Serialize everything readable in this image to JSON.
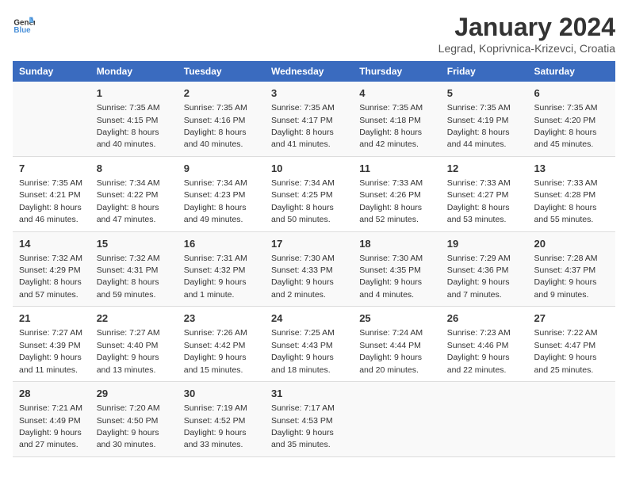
{
  "logo": {
    "line1": "General",
    "line2": "Blue"
  },
  "title": "January 2024",
  "subtitle": "Legrad, Koprivnica-Krizevci, Croatia",
  "days_header": [
    "Sunday",
    "Monday",
    "Tuesday",
    "Wednesday",
    "Thursday",
    "Friday",
    "Saturday"
  ],
  "weeks": [
    [
      {
        "day": "",
        "sunrise": "",
        "sunset": "",
        "daylight": ""
      },
      {
        "day": "1",
        "sunrise": "Sunrise: 7:35 AM",
        "sunset": "Sunset: 4:15 PM",
        "daylight": "Daylight: 8 hours and 40 minutes."
      },
      {
        "day": "2",
        "sunrise": "Sunrise: 7:35 AM",
        "sunset": "Sunset: 4:16 PM",
        "daylight": "Daylight: 8 hours and 40 minutes."
      },
      {
        "day": "3",
        "sunrise": "Sunrise: 7:35 AM",
        "sunset": "Sunset: 4:17 PM",
        "daylight": "Daylight: 8 hours and 41 minutes."
      },
      {
        "day": "4",
        "sunrise": "Sunrise: 7:35 AM",
        "sunset": "Sunset: 4:18 PM",
        "daylight": "Daylight: 8 hours and 42 minutes."
      },
      {
        "day": "5",
        "sunrise": "Sunrise: 7:35 AM",
        "sunset": "Sunset: 4:19 PM",
        "daylight": "Daylight: 8 hours and 44 minutes."
      },
      {
        "day": "6",
        "sunrise": "Sunrise: 7:35 AM",
        "sunset": "Sunset: 4:20 PM",
        "daylight": "Daylight: 8 hours and 45 minutes."
      }
    ],
    [
      {
        "day": "7",
        "sunrise": "Sunrise: 7:35 AM",
        "sunset": "Sunset: 4:21 PM",
        "daylight": "Daylight: 8 hours and 46 minutes."
      },
      {
        "day": "8",
        "sunrise": "Sunrise: 7:34 AM",
        "sunset": "Sunset: 4:22 PM",
        "daylight": "Daylight: 8 hours and 47 minutes."
      },
      {
        "day": "9",
        "sunrise": "Sunrise: 7:34 AM",
        "sunset": "Sunset: 4:23 PM",
        "daylight": "Daylight: 8 hours and 49 minutes."
      },
      {
        "day": "10",
        "sunrise": "Sunrise: 7:34 AM",
        "sunset": "Sunset: 4:25 PM",
        "daylight": "Daylight: 8 hours and 50 minutes."
      },
      {
        "day": "11",
        "sunrise": "Sunrise: 7:33 AM",
        "sunset": "Sunset: 4:26 PM",
        "daylight": "Daylight: 8 hours and 52 minutes."
      },
      {
        "day": "12",
        "sunrise": "Sunrise: 7:33 AM",
        "sunset": "Sunset: 4:27 PM",
        "daylight": "Daylight: 8 hours and 53 minutes."
      },
      {
        "day": "13",
        "sunrise": "Sunrise: 7:33 AM",
        "sunset": "Sunset: 4:28 PM",
        "daylight": "Daylight: 8 hours and 55 minutes."
      }
    ],
    [
      {
        "day": "14",
        "sunrise": "Sunrise: 7:32 AM",
        "sunset": "Sunset: 4:29 PM",
        "daylight": "Daylight: 8 hours and 57 minutes."
      },
      {
        "day": "15",
        "sunrise": "Sunrise: 7:32 AM",
        "sunset": "Sunset: 4:31 PM",
        "daylight": "Daylight: 8 hours and 59 minutes."
      },
      {
        "day": "16",
        "sunrise": "Sunrise: 7:31 AM",
        "sunset": "Sunset: 4:32 PM",
        "daylight": "Daylight: 9 hours and 1 minute."
      },
      {
        "day": "17",
        "sunrise": "Sunrise: 7:30 AM",
        "sunset": "Sunset: 4:33 PM",
        "daylight": "Daylight: 9 hours and 2 minutes."
      },
      {
        "day": "18",
        "sunrise": "Sunrise: 7:30 AM",
        "sunset": "Sunset: 4:35 PM",
        "daylight": "Daylight: 9 hours and 4 minutes."
      },
      {
        "day": "19",
        "sunrise": "Sunrise: 7:29 AM",
        "sunset": "Sunset: 4:36 PM",
        "daylight": "Daylight: 9 hours and 7 minutes."
      },
      {
        "day": "20",
        "sunrise": "Sunrise: 7:28 AM",
        "sunset": "Sunset: 4:37 PM",
        "daylight": "Daylight: 9 hours and 9 minutes."
      }
    ],
    [
      {
        "day": "21",
        "sunrise": "Sunrise: 7:27 AM",
        "sunset": "Sunset: 4:39 PM",
        "daylight": "Daylight: 9 hours and 11 minutes."
      },
      {
        "day": "22",
        "sunrise": "Sunrise: 7:27 AM",
        "sunset": "Sunset: 4:40 PM",
        "daylight": "Daylight: 9 hours and 13 minutes."
      },
      {
        "day": "23",
        "sunrise": "Sunrise: 7:26 AM",
        "sunset": "Sunset: 4:42 PM",
        "daylight": "Daylight: 9 hours and 15 minutes."
      },
      {
        "day": "24",
        "sunrise": "Sunrise: 7:25 AM",
        "sunset": "Sunset: 4:43 PM",
        "daylight": "Daylight: 9 hours and 18 minutes."
      },
      {
        "day": "25",
        "sunrise": "Sunrise: 7:24 AM",
        "sunset": "Sunset: 4:44 PM",
        "daylight": "Daylight: 9 hours and 20 minutes."
      },
      {
        "day": "26",
        "sunrise": "Sunrise: 7:23 AM",
        "sunset": "Sunset: 4:46 PM",
        "daylight": "Daylight: 9 hours and 22 minutes."
      },
      {
        "day": "27",
        "sunrise": "Sunrise: 7:22 AM",
        "sunset": "Sunset: 4:47 PM",
        "daylight": "Daylight: 9 hours and 25 minutes."
      }
    ],
    [
      {
        "day": "28",
        "sunrise": "Sunrise: 7:21 AM",
        "sunset": "Sunset: 4:49 PM",
        "daylight": "Daylight: 9 hours and 27 minutes."
      },
      {
        "day": "29",
        "sunrise": "Sunrise: 7:20 AM",
        "sunset": "Sunset: 4:50 PM",
        "daylight": "Daylight: 9 hours and 30 minutes."
      },
      {
        "day": "30",
        "sunrise": "Sunrise: 7:19 AM",
        "sunset": "Sunset: 4:52 PM",
        "daylight": "Daylight: 9 hours and 33 minutes."
      },
      {
        "day": "31",
        "sunrise": "Sunrise: 7:17 AM",
        "sunset": "Sunset: 4:53 PM",
        "daylight": "Daylight: 9 hours and 35 minutes."
      },
      {
        "day": "",
        "sunrise": "",
        "sunset": "",
        "daylight": ""
      },
      {
        "day": "",
        "sunrise": "",
        "sunset": "",
        "daylight": ""
      },
      {
        "day": "",
        "sunrise": "",
        "sunset": "",
        "daylight": ""
      }
    ]
  ]
}
